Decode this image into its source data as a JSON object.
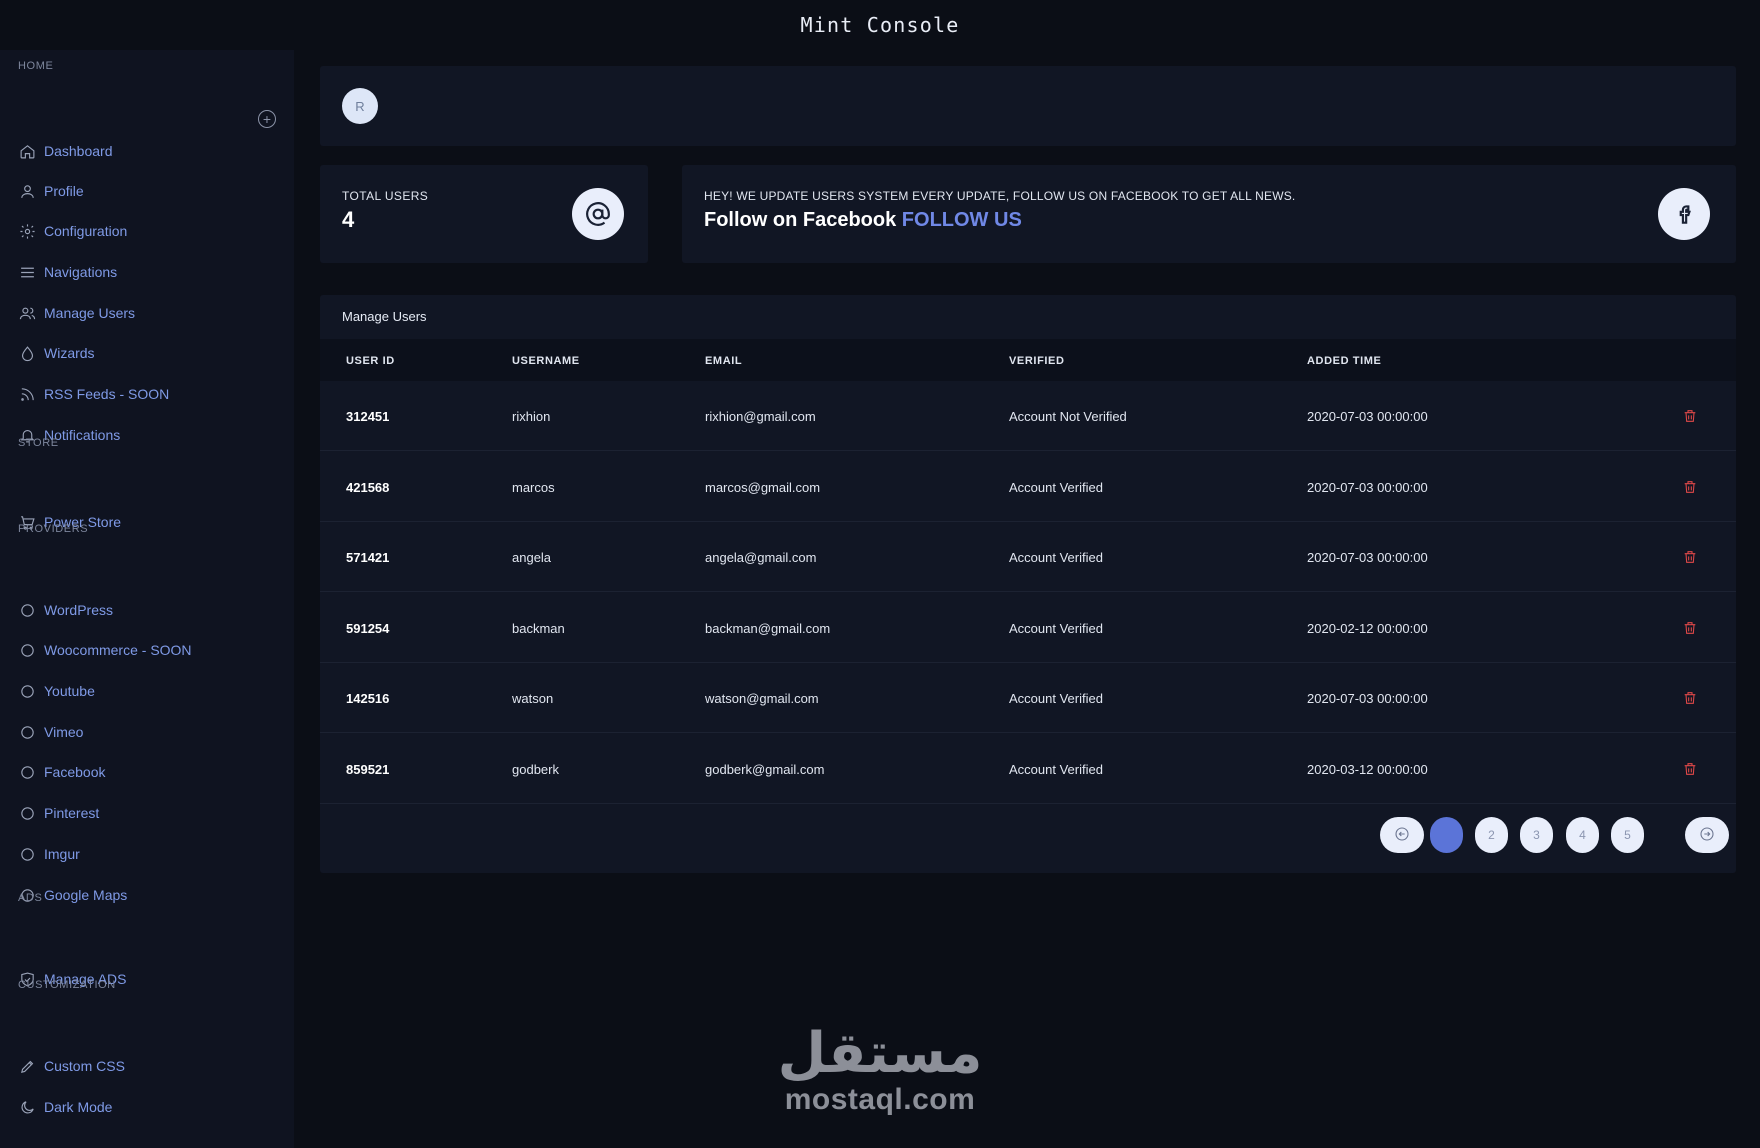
{
  "window": {
    "title": "Mint Console"
  },
  "sidebar": {
    "sections": [
      {
        "heading": "HOME",
        "items": [
          "Dashboard",
          "Profile",
          "Configuration",
          "Navigations",
          "Manage Users",
          "Wizards",
          "RSS Feeds - SOON",
          "Notifications"
        ]
      },
      {
        "heading": "STORE",
        "items": [
          "Power Store"
        ]
      },
      {
        "heading": "PROVIDERS",
        "items": [
          "WordPress",
          "Woocommerce - SOON",
          "Youtube",
          "Vimeo",
          "Facebook",
          "Pinterest",
          "Imgur",
          "Google Maps"
        ]
      },
      {
        "heading": "ADS",
        "items": [
          "Manage ADS"
        ]
      },
      {
        "heading": "CUSTOMIZATION",
        "items": [
          "Custom CSS",
          "Dark Mode"
        ]
      }
    ],
    "icons": {
      "Dashboard": "home-icon",
      "Profile": "user-icon",
      "Configuration": "gear-icon",
      "Navigations": "menu-icon",
      "Manage Users": "users-icon",
      "Wizards": "drop-icon",
      "RSS Feeds - SOON": "rss-icon",
      "Notifications": "bell-icon",
      "Power Store": "cart-icon",
      "WordPress": "circle-icon",
      "Woocommerce - SOON": "circle-icon",
      "Youtube": "circle-icon",
      "Vimeo": "circle-icon",
      "Facebook": "circle-icon",
      "Pinterest": "circle-icon",
      "Imgur": "circle-icon",
      "Google Maps": "circle-icon",
      "Manage ADS": "shield-icon",
      "Custom CSS": "pen-icon",
      "Dark Mode": "moon-icon"
    }
  },
  "header": {
    "avatar_initial": "R"
  },
  "stats": {
    "total_users_label": "TOTAL USERS",
    "total_users_value": "4",
    "icon": "at-icon"
  },
  "promo": {
    "note": "HEY! WE UPDATE USERS SYSTEM EVERY UPDATE, FOLLOW US ON FACEBOOK TO GET ALL NEWS.",
    "line": "Follow on Facebook",
    "link": "FOLLOW US",
    "icon": "facebook-icon"
  },
  "users_table": {
    "title": "Manage Users",
    "columns": [
      "USER ID",
      "USERNAME",
      "EMAIL",
      "VERIFIED",
      "ADDED TIME"
    ],
    "rows": [
      [
        "312451",
        "rixhion",
        "rixhion@gmail.com",
        "Account Not Verified",
        "2020-07-03 00:00:00"
      ],
      [
        "421568",
        "marcos",
        "marcos@gmail.com",
        "Account Verified",
        "2020-07-03 00:00:00"
      ],
      [
        "571421",
        "angela",
        "angela@gmail.com",
        "Account Verified",
        "2020-07-03 00:00:00"
      ],
      [
        "591254",
        "backman",
        "backman@gmail.com",
        "Account Verified",
        "2020-02-12 00:00:00"
      ],
      [
        "142516",
        "watson",
        "watson@gmail.com",
        "Account Verified",
        "2020-07-03 00:00:00"
      ],
      [
        "859521",
        "godberk",
        "godberk@gmail.com",
        "Account Verified",
        "2020-03-12 00:00:00"
      ]
    ],
    "row_action_icon": "trash-icon"
  },
  "pagination": {
    "pages": [
      "",
      "2",
      "3",
      "4",
      "5"
    ],
    "current_page_index": 0,
    "prev_icon": "arrow-left-icon",
    "next_icon": "arrow-right-icon"
  },
  "watermark": {
    "arabic": "مستقل",
    "latin": "mostaql.com"
  },
  "colors": {
    "background": "#0b0e16",
    "sidebar": "#0f1320",
    "card": "#111624",
    "accent": "#7088e6",
    "link": "#7f9ae6",
    "danger": "#e04848",
    "active_page": "#5b74d8"
  }
}
